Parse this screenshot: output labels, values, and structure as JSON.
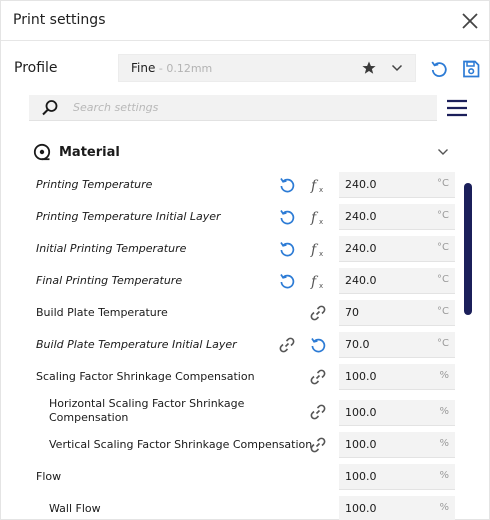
{
  "window": {
    "title": "Print settings"
  },
  "profile": {
    "label": "Profile",
    "name": "Fine",
    "sub": " - 0.12mm"
  },
  "search": {
    "placeholder": "Search settings"
  },
  "section": {
    "title": "Material"
  },
  "rows": [
    {
      "label": "Printing Temperature",
      "value": "240.0",
      "unit": "°C"
    },
    {
      "label": "Printing Temperature Initial Layer",
      "value": "240.0",
      "unit": "°C"
    },
    {
      "label": "Initial Printing Temperature",
      "value": "240.0",
      "unit": "°C"
    },
    {
      "label": "Final Printing Temperature",
      "value": "240.0",
      "unit": "°C"
    },
    {
      "label": "Build Plate Temperature",
      "value": "70",
      "unit": "°C"
    },
    {
      "label": "Build Plate Temperature Initial Layer",
      "value": "70.0",
      "unit": "°C"
    },
    {
      "label": "Scaling Factor Shrinkage Compensation",
      "value": "100.0",
      "unit": "%"
    },
    {
      "label": "Horizontal Scaling Factor Shrinkage Compensation",
      "value": "100.0",
      "unit": "%"
    },
    {
      "label": "Vertical Scaling Factor Shrinkage Compensation",
      "value": "100.0",
      "unit": "%"
    },
    {
      "label": "Flow",
      "value": "100.0",
      "unit": "%"
    },
    {
      "label": "Wall Flow",
      "value": "100.0",
      "unit": "%"
    }
  ],
  "colors": {
    "accent": "#2c7bd5",
    "scrollbar": "#1b1f5a",
    "icon": "#555555"
  },
  "icons": [
    "close-icon",
    "star-icon",
    "chevron-down-icon",
    "reset-icon",
    "save-icon",
    "search-icon",
    "hamburger-menu-icon",
    "material-icon",
    "function-icon",
    "link-icon"
  ]
}
